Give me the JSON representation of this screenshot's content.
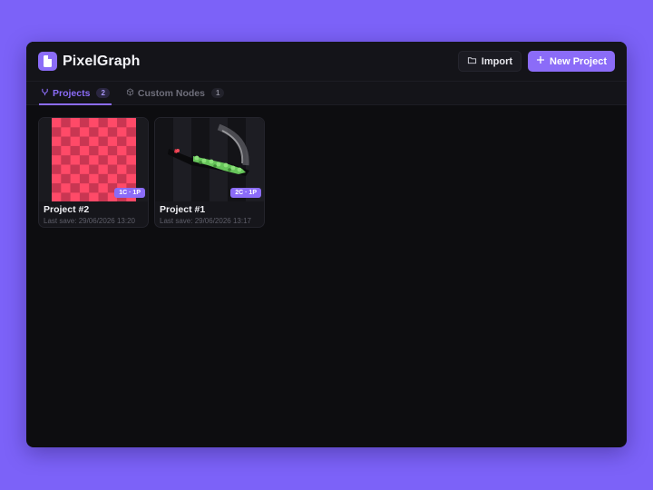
{
  "app": {
    "name": "PixelGraph",
    "colors": {
      "accent": "#8b6cf8",
      "background": "#7c62f8",
      "panel": "#0d0d10"
    }
  },
  "toolbar": {
    "import_label": "Import",
    "import_icon": "folder-icon",
    "new_project_label": "New Project",
    "new_project_icon": "plus-icon"
  },
  "tabs": [
    {
      "label": "Projects",
      "count": "2",
      "icon": "graph-branch-icon",
      "active": true
    },
    {
      "label": "Custom Nodes",
      "count": "1",
      "icon": "cube-icon",
      "active": false
    }
  ],
  "projects": [
    {
      "title": "Project #2",
      "last_save": "Last save: 29/06/2026 13:20",
      "badge": "1C · 1P",
      "thumbnail": "checkerboard-red"
    },
    {
      "title": "Project #1",
      "last_save": "Last save: 29/06/2026 13:17",
      "badge": "2C · 1P",
      "thumbnail": "green-spiky-sprite"
    }
  ]
}
